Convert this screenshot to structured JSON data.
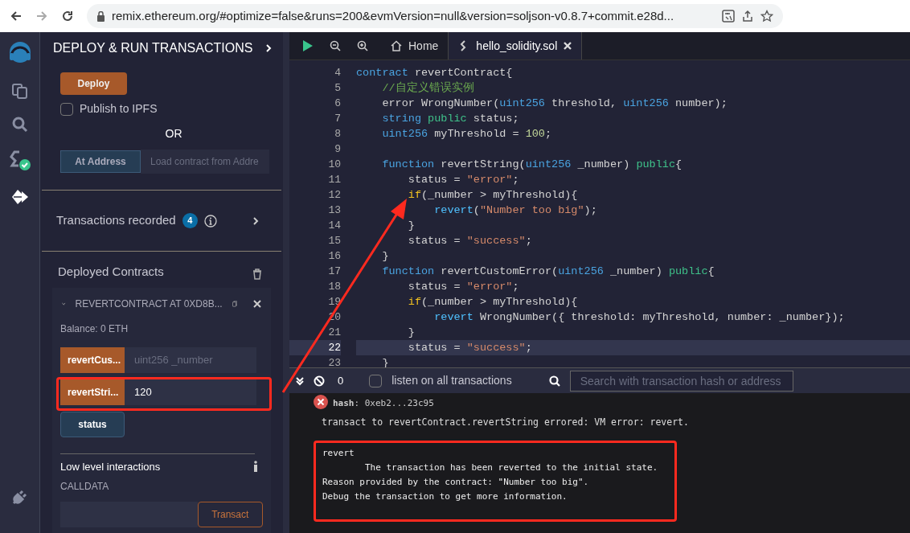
{
  "browser": {
    "url": "remix.ethereum.org/#optimize=false&runs=200&evmVersion=null&version=soljson-v0.8.7+commit.e28d..."
  },
  "panel": {
    "title": "DEPLOY & RUN TRANSACTIONS",
    "deploy_button": "Deploy",
    "publish": {
      "label": "Publish to IPFS",
      "checked": false
    },
    "or": "OR",
    "at_address_button": "At Address",
    "address_placeholder": "Load contract from Addre",
    "transactions": {
      "label": "Transactions recorded",
      "count": "4"
    },
    "deployed": {
      "title": "Deployed Contracts",
      "contract": "REVERTCONTRACT AT 0XD8B...",
      "balance": "Balance: 0 ETH",
      "functions": [
        {
          "kind": "transact",
          "label": "revertCus...",
          "placeholder": "uint256 _number",
          "highlighted": false
        },
        {
          "kind": "transact",
          "label": "revertStri...",
          "value": "120",
          "highlighted": true
        },
        {
          "kind": "call",
          "label": "status",
          "highlighted": false
        }
      ],
      "low_level": "Low level interactions",
      "calldata": "CALLDATA",
      "transact_button": "Transact"
    }
  },
  "tabs": [
    {
      "label": "Home",
      "selected": false
    },
    {
      "label": "hello_solidity.sol",
      "selected": true
    }
  ],
  "editor": {
    "lines": [
      {
        "n": "4",
        "current": false,
        "tokens": [
          {
            "text": "contract",
            "color": "#4aa3e0"
          },
          {
            "text": " revertContract{",
            "color": "#d4d4d4"
          }
        ]
      },
      {
        "n": "5",
        "current": false,
        "tokens": [
          {
            "text": "    //自定义错误实例",
            "color": "#6aa84f"
          }
        ]
      },
      {
        "n": "6",
        "current": false,
        "tokens": [
          {
            "text": "    error WrongNumber(",
            "color": "#d4d4d4"
          },
          {
            "text": "uint256",
            "color": "#4aa3e0"
          },
          {
            "text": " threshold, ",
            "color": "#d4d4d4"
          },
          {
            "text": "uint256",
            "color": "#4aa3e0"
          },
          {
            "text": " number);",
            "color": "#d4d4d4"
          }
        ]
      },
      {
        "n": "7",
        "current": false,
        "tokens": [
          {
            "text": "    string",
            "color": "#4aa3e0"
          },
          {
            "text": " public",
            "color": "#3fc18a"
          },
          {
            "text": " status;",
            "color": "#d4d4d4"
          }
        ]
      },
      {
        "n": "8",
        "current": false,
        "tokens": [
          {
            "text": "    uint256",
            "color": "#4aa3e0"
          },
          {
            "text": " myThreshold = ",
            "color": "#d4d4d4"
          },
          {
            "text": "100",
            "color": "#c3d89a"
          },
          {
            "text": ";",
            "color": "#d4d4d4"
          }
        ]
      },
      {
        "n": "9",
        "current": false
      },
      {
        "n": "10",
        "current": false,
        "tokens": [
          {
            "text": "    function",
            "color": "#4aa3e0"
          },
          {
            "text": " revertString(",
            "color": "#d4d4d4"
          },
          {
            "text": "uint256",
            "color": "#4aa3e0"
          },
          {
            "text": " _number) ",
            "color": "#d4d4d4"
          },
          {
            "text": "public",
            "color": "#3fc18a"
          },
          {
            "text": "{",
            "color": "#d4d4d4"
          }
        ]
      },
      {
        "n": "11",
        "current": false,
        "tokens": [
          {
            "text": "        status = ",
            "color": "#d4d4d4"
          },
          {
            "text": "\"error\"",
            "color": "#d68a6a"
          },
          {
            "text": ";",
            "color": "#d4d4d4"
          }
        ]
      },
      {
        "n": "12",
        "current": false,
        "tokens": [
          {
            "text": "        if",
            "color": "#f0c020"
          },
          {
            "text": "(_number > myThreshold){",
            "color": "#d4d4d4"
          }
        ]
      },
      {
        "n": "13",
        "current": false,
        "tokens": [
          {
            "text": "            revert",
            "color": "#4fc1ff"
          },
          {
            "text": "(",
            "color": "#d4d4d4"
          },
          {
            "text": "\"Number too big\"",
            "color": "#d68a6a"
          },
          {
            "text": ");",
            "color": "#d4d4d4"
          }
        ]
      },
      {
        "n": "14",
        "current": false,
        "tokens": [
          {
            "text": "        }",
            "color": "#d4d4d4"
          }
        ]
      },
      {
        "n": "15",
        "current": false,
        "tokens": [
          {
            "text": "        status = ",
            "color": "#d4d4d4"
          },
          {
            "text": "\"success\"",
            "color": "#d68a6a"
          },
          {
            "text": ";",
            "color": "#d4d4d4"
          }
        ]
      },
      {
        "n": "16",
        "current": false,
        "tokens": [
          {
            "text": "    }",
            "color": "#d4d4d4"
          }
        ]
      },
      {
        "n": "17",
        "current": false,
        "tokens": [
          {
            "text": "    function",
            "color": "#4aa3e0"
          },
          {
            "text": " revertCustomError(",
            "color": "#d4d4d4"
          },
          {
            "text": "uint256",
            "color": "#4aa3e0"
          },
          {
            "text": " _number) ",
            "color": "#d4d4d4"
          },
          {
            "text": "public",
            "color": "#3fc18a"
          },
          {
            "text": "{",
            "color": "#d4d4d4"
          }
        ]
      },
      {
        "n": "18",
        "current": false,
        "tokens": [
          {
            "text": "        status = ",
            "color": "#d4d4d4"
          },
          {
            "text": "\"error\"",
            "color": "#d68a6a"
          },
          {
            "text": ";",
            "color": "#d4d4d4"
          }
        ]
      },
      {
        "n": "19",
        "current": false,
        "tokens": [
          {
            "text": "        if",
            "color": "#f0c020"
          },
          {
            "text": "(_number > myThreshold){",
            "color": "#d4d4d4"
          }
        ]
      },
      {
        "n": "20",
        "current": false,
        "tokens": [
          {
            "text": "            revert",
            "color": "#4fc1ff"
          },
          {
            "text": " WrongNumber({ threshold: myThreshold, number: _number});",
            "color": "#d4d4d4"
          }
        ]
      },
      {
        "n": "21",
        "current": false,
        "tokens": [
          {
            "text": "        }",
            "color": "#d4d4d4"
          }
        ]
      },
      {
        "n": "22",
        "current": true,
        "tokens": [
          {
            "text": "        status = ",
            "color": "#d4d4d4"
          },
          {
            "text": "\"success\"",
            "color": "#d68a6a"
          },
          {
            "text": ";",
            "color": "#d4d4d4"
          }
        ]
      },
      {
        "n": "23",
        "current": false,
        "tokens": [
          {
            "text": "    }",
            "color": "#d4d4d4"
          }
        ]
      }
    ]
  },
  "terminal": {
    "count": "0",
    "listen": {
      "label": "listen on all transactions",
      "checked": false
    },
    "search_placeholder": "Search with transaction hash or address",
    "hash": "**hash**: 0xeb2...23c95",
    "error_line": "transact to revertContract.revertString errored: VM error: revert.",
    "message": {
      "highlighted": true,
      "lines": [
        "revert",
        "        The transaction has been reverted to the initial state.",
        "Reason provided by the contract: \"Number too big\".",
        "Debug the transaction to get more information."
      ]
    }
  }
}
